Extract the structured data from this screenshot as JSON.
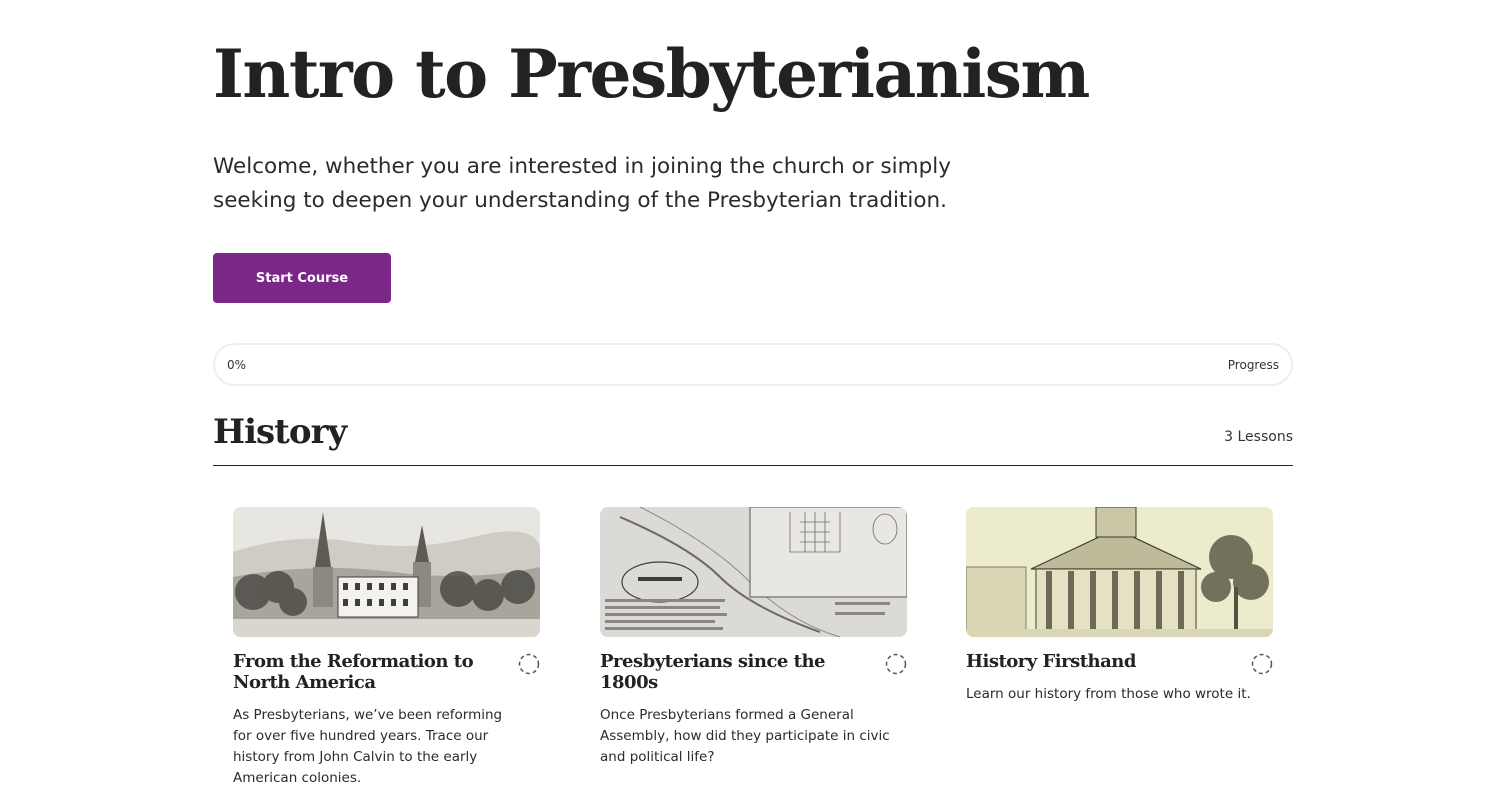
{
  "course": {
    "title": "Intro to Presbyterianism",
    "intro": "Welcome, whether you are interested in joining the church or simply seeking to deepen your understanding of the Presbyterian tradition.",
    "start_label": "Start Course"
  },
  "progress": {
    "percent_label": "0%",
    "label": "Progress",
    "fraction": 0
  },
  "section": {
    "title": "History",
    "count_label": "3 Lessons"
  },
  "lessons": [
    {
      "title": "From the Reformation to North America",
      "description": "As Presbyterians, we’ve been reforming for over five hundred years. Trace our history from John Calvin to the early American colonies.",
      "status_icon": "incomplete-circle-icon"
    },
    {
      "title": "Presbyterians since the 1800s",
      "description": "Once Presbyterians formed a General Assembly, how did they participate in civic and political life?",
      "status_icon": "incomplete-circle-icon"
    },
    {
      "title": "History Firsthand",
      "description": "Learn our history from those who wrote it.",
      "status_icon": "incomplete-circle-icon"
    }
  ],
  "colors": {
    "accent": "#7a2787",
    "text": "#222222",
    "progress_border": "#eeeeee"
  }
}
